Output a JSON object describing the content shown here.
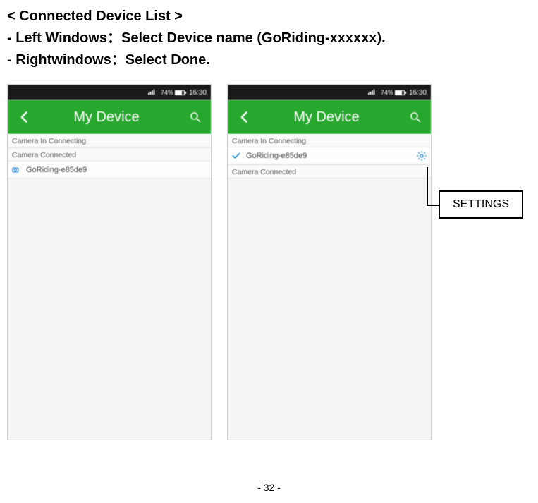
{
  "heading": {
    "line1": "< Connected Device List >",
    "line2_a": "- Left Windows",
    "line2_colon": "：",
    "line2_b": "Select Device name (GoRiding-xxxxxx).",
    "line3_a": "- Rightwindows",
    "line3_colon": "：",
    "line3_b": "Select Done."
  },
  "statusbar": {
    "battery_pct": "74%",
    "time": "16:30"
  },
  "titlebar": {
    "title": "My Device"
  },
  "labels": {
    "connecting": "Camera In Connecting",
    "connected": "Camera Connected"
  },
  "device": {
    "name": "GoRiding-e85de9"
  },
  "callout": {
    "text": "SETTINGS"
  },
  "footer": {
    "page": "- 32 -"
  }
}
